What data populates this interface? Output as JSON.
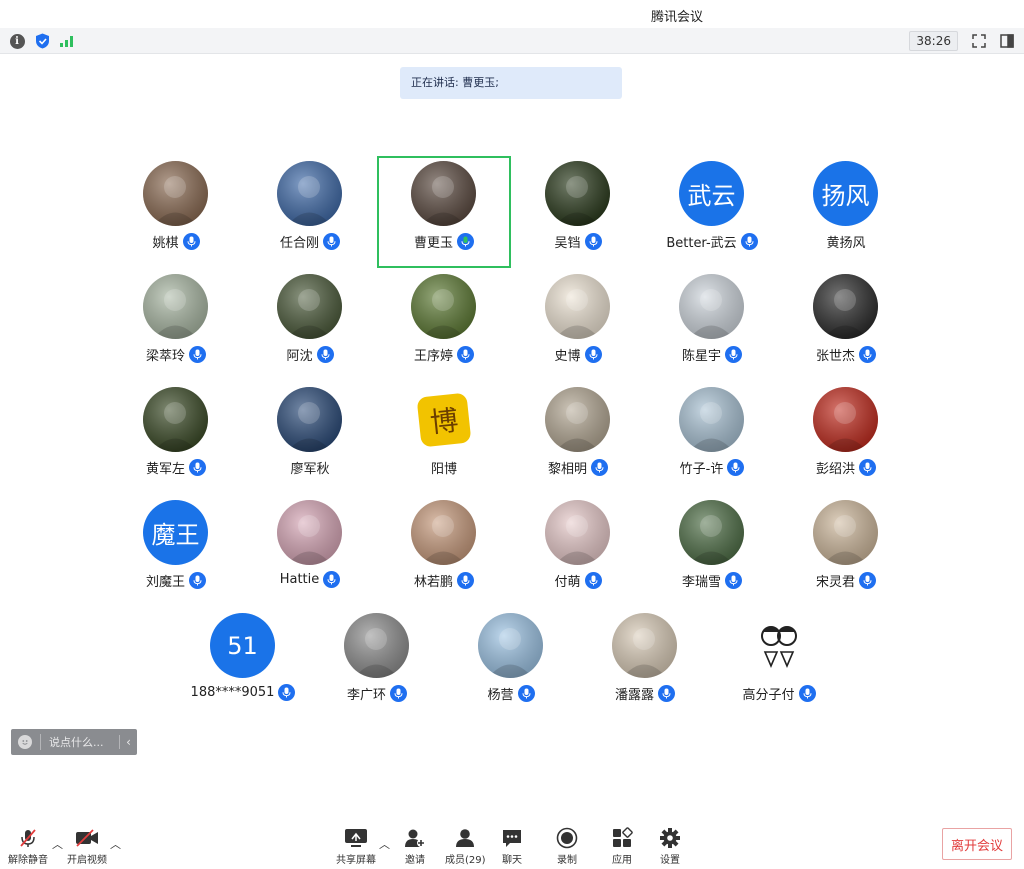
{
  "window": {
    "title": "腾讯会议"
  },
  "infobar": {
    "timer": "38:26"
  },
  "speaking": {
    "text": "正在讲话: 曹更玉;"
  },
  "participants": [
    {
      "name": "姚棋",
      "avatar_text": "",
      "bg": "#8a6a52",
      "mic": "blue"
    },
    {
      "name": "任合刚",
      "avatar_text": "",
      "bg": "#3f6aa8",
      "mic": "blue"
    },
    {
      "name": "曹更玉",
      "avatar_text": "",
      "bg": "#5b4a40",
      "mic": "green",
      "active": true
    },
    {
      "name": "吴铛",
      "avatar_text": "",
      "bg": "#2a3a1c",
      "mic": "blue"
    },
    {
      "name": "Better-武云",
      "avatar_text": "武云",
      "bg": "#1a73e8",
      "mic": "blue"
    },
    {
      "name": "黄扬风",
      "avatar_text": "扬风",
      "bg": "#1a73e8",
      "mic": "none"
    },
    {
      "name": "梁萃玲",
      "avatar_text": "",
      "bg": "#a9b7a3",
      "mic": "blue"
    },
    {
      "name": "阿沈",
      "avatar_text": "",
      "bg": "#4b5a3a",
      "mic": "blue"
    },
    {
      "name": "王序婷",
      "avatar_text": "",
      "bg": "#5d7a34",
      "mic": "blue"
    },
    {
      "name": "史博",
      "avatar_text": "",
      "bg": "#ede3d3",
      "mic": "blue"
    },
    {
      "name": "陈星宇",
      "avatar_text": "",
      "bg": "#cfd6dd",
      "mic": "blue"
    },
    {
      "name": "张世杰",
      "avatar_text": "",
      "bg": "#2b2b2b",
      "mic": "blue"
    },
    {
      "name": "黄军左",
      "avatar_text": "",
      "bg": "#3a4a26",
      "mic": "blue"
    },
    {
      "name": "廖军秋",
      "avatar_text": "",
      "bg": "#2a4a78",
      "mic": "none"
    },
    {
      "name": "阳博",
      "avatar_text": "",
      "bg": "#ffffff",
      "mic": "none"
    },
    {
      "name": "黎相明",
      "avatar_text": "",
      "bg": "#b3a793",
      "mic": "blue"
    },
    {
      "name": "竹子-许",
      "avatar_text": "",
      "bg": "#a9c2d4",
      "mic": "blue"
    },
    {
      "name": "彭绍洪",
      "avatar_text": "",
      "bg": "#c12b1e",
      "mic": "blue"
    },
    {
      "name": "刘魔王",
      "avatar_text": "魔王",
      "bg": "#1a73e8",
      "mic": "blue"
    },
    {
      "name": "Hattie",
      "avatar_text": "",
      "bg": "#d7a6b6",
      "mic": "blue"
    },
    {
      "name": "林若鹏",
      "avatar_text": "",
      "bg": "#c79a7c",
      "mic": "blue"
    },
    {
      "name": "付萌",
      "avatar_text": "",
      "bg": "#e7c9c9",
      "mic": "blue"
    },
    {
      "name": "李瑞雪",
      "avatar_text": "",
      "bg": "#4e6e46",
      "mic": "blue"
    },
    {
      "name": "宋灵君",
      "avatar_text": "",
      "bg": "#cdb79b",
      "mic": "blue"
    },
    {
      "name": "188****9051",
      "avatar_text": "51",
      "bg": "#1a73e8",
      "mic": "blue"
    },
    {
      "name": "李广环",
      "avatar_text": "",
      "bg": "#8d8d8d",
      "mic": "blue"
    },
    {
      "name": "杨营",
      "avatar_text": "",
      "bg": "#9cc3e4",
      "mic": "blue"
    },
    {
      "name": "潘露露",
      "avatar_text": "",
      "bg": "#d9cbb7",
      "mic": "blue"
    },
    {
      "name": "高分子付",
      "avatar_text": "",
      "bg": "#ffffff",
      "mic": "blue"
    }
  ],
  "avatar_yangbo_char": "博",
  "chat": {
    "placeholder": "说点什么..."
  },
  "toolbar": {
    "unmute": "解除静音",
    "start_video": "开启视频",
    "share_screen": "共享屏幕",
    "invite": "邀请",
    "members": "成员(29)",
    "chat": "聊天",
    "record": "录制",
    "apps": "应用",
    "settings": "设置",
    "leave": "离开会议"
  }
}
